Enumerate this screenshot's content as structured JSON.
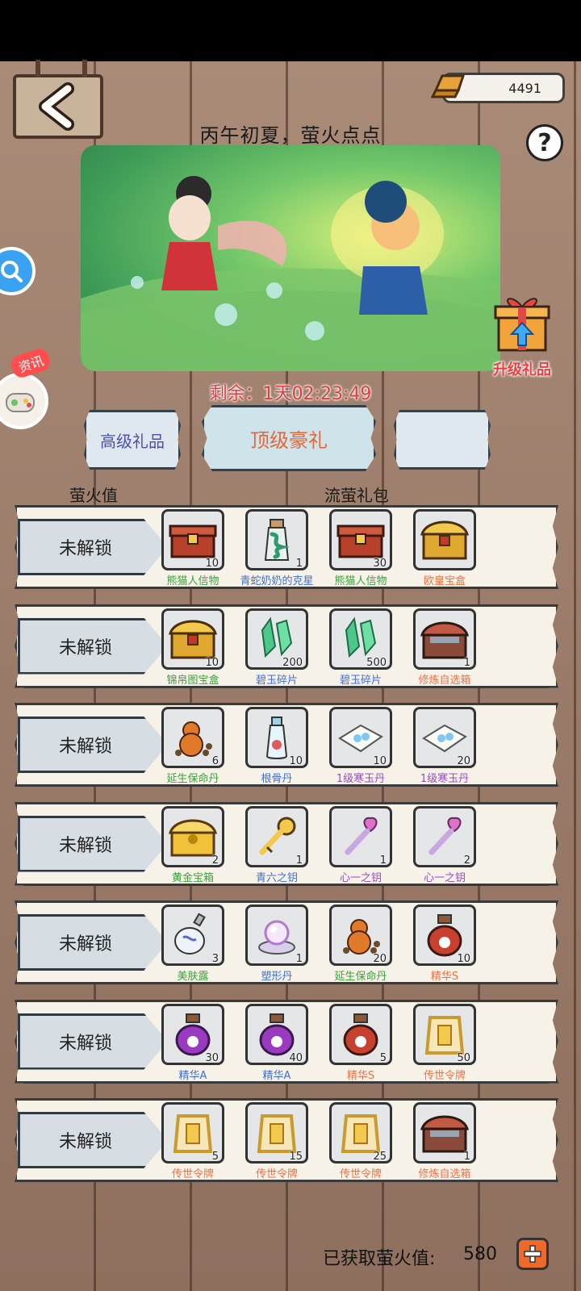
{
  "header": {
    "gold_amount": "4491",
    "help_label": "?",
    "event_title": "丙午初夏，萤火点点",
    "countdown": "剩余：1天02:23:49"
  },
  "side": {
    "news_tag": "资讯",
    "upgrade_gift_label": "升级礼品"
  },
  "tabs": [
    {
      "label": "高级礼品"
    },
    {
      "label": "顶级豪礼"
    },
    {
      "label": ""
    }
  ],
  "columns": {
    "left": "萤火值",
    "right": "流萤礼包"
  },
  "rows": [
    {
      "status": "未解锁",
      "items": [
        {
          "name": "熊猫人信物",
          "qty": "10",
          "icon": "chest-red-icon"
        },
        {
          "name": "青蛇奶奶的克星",
          "qty": "1",
          "icon": "bottle-snake-icon"
        },
        {
          "name": "熊猫人信物",
          "qty": "30",
          "icon": "chest-red-icon"
        },
        {
          "name": "欧皇宝盒",
          "qty": "",
          "icon": "chest-gold-icon"
        }
      ]
    },
    {
      "status": "未解锁",
      "items": [
        {
          "name": "锦帛图宝盒",
          "qty": "10",
          "icon": "chest-gold-icon"
        },
        {
          "name": "碧玉碎片",
          "qty": "200",
          "icon": "jade-shard-icon"
        },
        {
          "name": "碧玉碎片",
          "qty": "500",
          "icon": "jade-shard-icon"
        },
        {
          "name": "修炼自选箱",
          "qty": "1",
          "icon": "chest-choice-icon"
        }
      ]
    },
    {
      "status": "未解锁",
      "items": [
        {
          "name": "延生保命丹",
          "qty": "6",
          "icon": "gourd-pill-icon"
        },
        {
          "name": "根骨丹",
          "qty": "10",
          "icon": "vial-icon"
        },
        {
          "name": "1级寒玉丹",
          "qty": "10",
          "icon": "paper-pill-icon"
        },
        {
          "name": "1级寒玉丹",
          "qty": "20",
          "icon": "paper-pill-icon"
        }
      ]
    },
    {
      "status": "未解锁",
      "items": [
        {
          "name": "黄金宝箱",
          "qty": "2",
          "icon": "chest-yellow-icon"
        },
        {
          "name": "青六之钥",
          "qty": "1",
          "icon": "key-gold-icon"
        },
        {
          "name": "心一之钥",
          "qty": "1",
          "icon": "key-heart-icon"
        },
        {
          "name": "心一之钥",
          "qty": "2",
          "icon": "key-heart-icon"
        }
      ]
    },
    {
      "status": "未解锁",
      "items": [
        {
          "name": "美肤露",
          "qty": "3",
          "icon": "perfume-icon"
        },
        {
          "name": "塑形丹",
          "qty": "1",
          "icon": "pearl-icon"
        },
        {
          "name": "延生保命丹",
          "qty": "20",
          "icon": "gourd-pill-icon"
        },
        {
          "name": "精华S",
          "qty": "10",
          "icon": "essence-red-icon"
        }
      ]
    },
    {
      "status": "未解锁",
      "items": [
        {
          "name": "精华A",
          "qty": "30",
          "icon": "essence-purple-icon"
        },
        {
          "name": "精华A",
          "qty": "40",
          "icon": "essence-purple-icon"
        },
        {
          "name": "精华S",
          "qty": "5",
          "icon": "essence-red-icon"
        },
        {
          "name": "传世令牌",
          "qty": "50",
          "icon": "token-icon"
        }
      ]
    },
    {
      "status": "未解锁",
      "items": [
        {
          "name": "传世令牌",
          "qty": "5",
          "icon": "token-icon"
        },
        {
          "name": "传世令牌",
          "qty": "15",
          "icon": "token-icon"
        },
        {
          "name": "传世令牌",
          "qty": "25",
          "icon": "token-icon"
        },
        {
          "name": "修炼自选箱",
          "qty": "1",
          "icon": "chest-choice-icon"
        }
      ]
    }
  ],
  "footer": {
    "label": "已获取萤火值:",
    "value": "580"
  }
}
